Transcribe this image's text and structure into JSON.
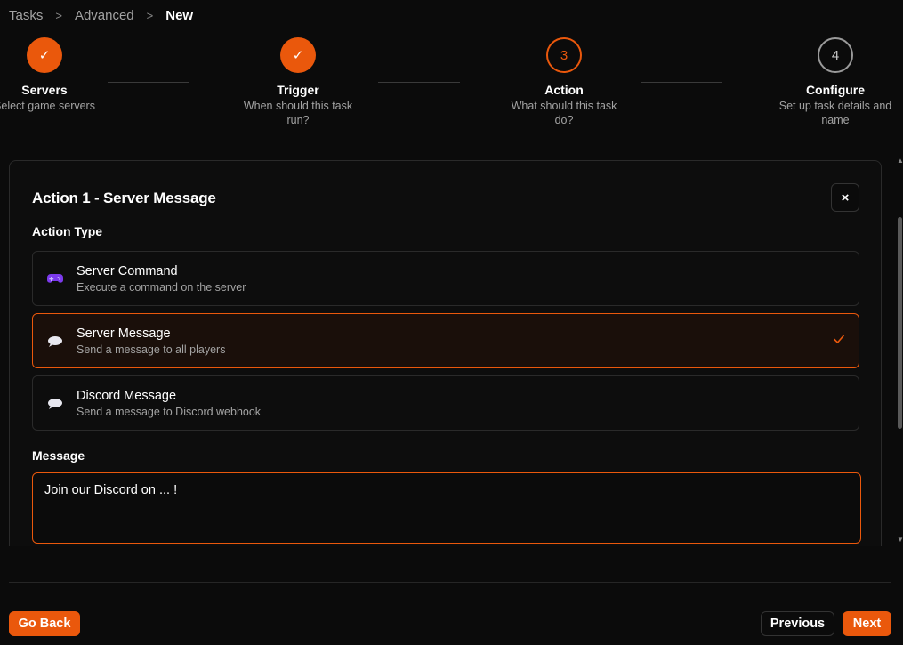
{
  "breadcrumb": {
    "items": [
      "Tasks",
      "Advanced",
      "New"
    ],
    "separator": ">"
  },
  "steps": [
    {
      "title": "Servers",
      "desc": "Select game servers",
      "state": "done",
      "mark": "✓"
    },
    {
      "title": "Trigger",
      "desc": "When should this task run?",
      "state": "done",
      "mark": "✓"
    },
    {
      "title": "Action",
      "desc": "What should this task do?",
      "state": "active",
      "mark": "3"
    },
    {
      "title": "Configure",
      "desc": "Set up task details and name",
      "state": "pending",
      "mark": "4"
    }
  ],
  "action": {
    "title": "Action 1 - Server Message",
    "close_label": "×",
    "type_label": "Action Type",
    "options": [
      {
        "title": "Server Command",
        "desc": "Execute a command on the server",
        "icon": "gamepad-icon",
        "selected": false
      },
      {
        "title": "Server Message",
        "desc": "Send a message to all players",
        "icon": "speech-bubble-icon",
        "selected": true
      },
      {
        "title": "Discord Message",
        "desc": "Send a message to Discord webhook",
        "icon": "speech-bubble-icon",
        "selected": false
      }
    ],
    "message_label": "Message",
    "message_value": "Join our Discord on ... !"
  },
  "footer": {
    "back_label": "Go Back",
    "previous_label": "Previous",
    "next_label": "Next"
  },
  "colors": {
    "accent": "#ea580c",
    "background": "#0b0b0b",
    "muted_text": "#a3a3a3",
    "border": "#2a2a2a"
  }
}
